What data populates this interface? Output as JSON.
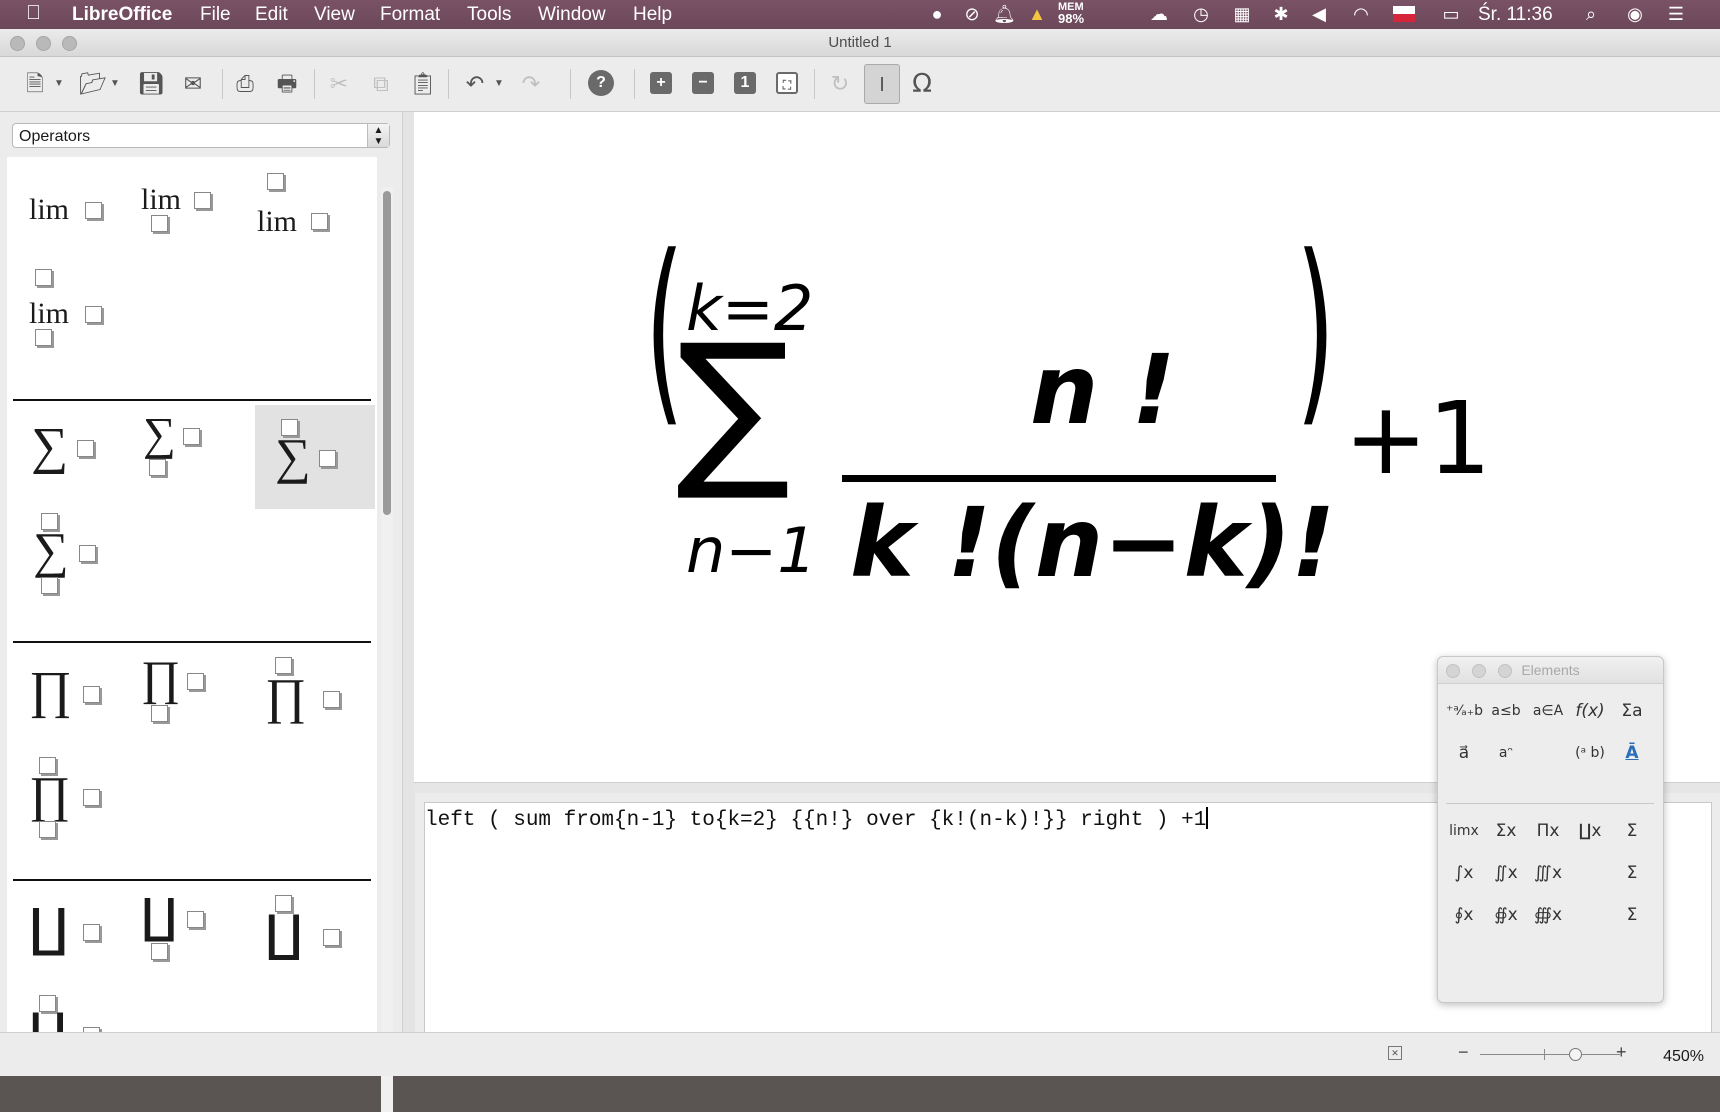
{
  "menubar": {
    "apple_icon": "apple-icon",
    "app": "LibreOffice",
    "items": [
      "File",
      "Edit",
      "View",
      "Format",
      "Tools",
      "Window",
      "Help"
    ],
    "mem_label": "MEM",
    "mem_value": "98%",
    "clock": "Śr. 11:36"
  },
  "window": {
    "title": "Untitled 1"
  },
  "toolbar": {
    "icons": [
      "new-icon",
      "open-icon",
      "save-icon",
      "email-icon",
      "export-pdf-icon",
      "print-icon",
      "cut-icon",
      "copy-icon",
      "paste-icon",
      "undo-icon",
      "redo-icon",
      "help-icon",
      "zoom-in-icon",
      "zoom-out-icon",
      "zoom-100-icon",
      "show-all-icon",
      "update-icon",
      "formula-cursor-icon",
      "symbols-icon"
    ],
    "zoom_in": "+",
    "zoom_out": "−",
    "zoom_100": "1",
    "help": "?",
    "symbols": "Ω"
  },
  "leftpanel": {
    "category": "Operators",
    "lim": "lim",
    "sum": "∑",
    "prod": "∏",
    "coprod": "∐"
  },
  "formula": {
    "k2": "k=2",
    "n1": "n−1",
    "sigma": "∑",
    "num": "n !",
    "den": "k !(n−k)!",
    "plus1": "+1",
    "lparen": "(",
    "rparen": ")"
  },
  "command": {
    "text": "left ( sum from{n-1} to{k=2} {{n!} over {k!(n-k)!}} right ) +1"
  },
  "statusbar": {
    "zoom": "450%"
  },
  "elements": {
    "title": "Elements",
    "categories": [
      "+a/a+b",
      "a≤b",
      "a∈A",
      "f(x)",
      "∑a",
      "a⃗",
      "a°",
      "",
      "(a/b)",
      "attributes"
    ],
    "cat_labels": [
      "⁺ᵃ⁄ₐ₊b",
      "a≤b",
      "a∈A",
      "f(x)",
      "Σa",
      "a⃗",
      "aᵔ",
      "",
      "(ᵃ b)",
      "Ā"
    ],
    "ops_row1": [
      "limx",
      "Σx",
      "Πx",
      "∐x",
      "Σ"
    ],
    "ops_row2": [
      "∫x",
      "∬x",
      "∭x",
      "",
      "Σ"
    ],
    "ops_row3": [
      "∮x",
      "∯x",
      "∰x",
      "",
      "Σ"
    ]
  }
}
